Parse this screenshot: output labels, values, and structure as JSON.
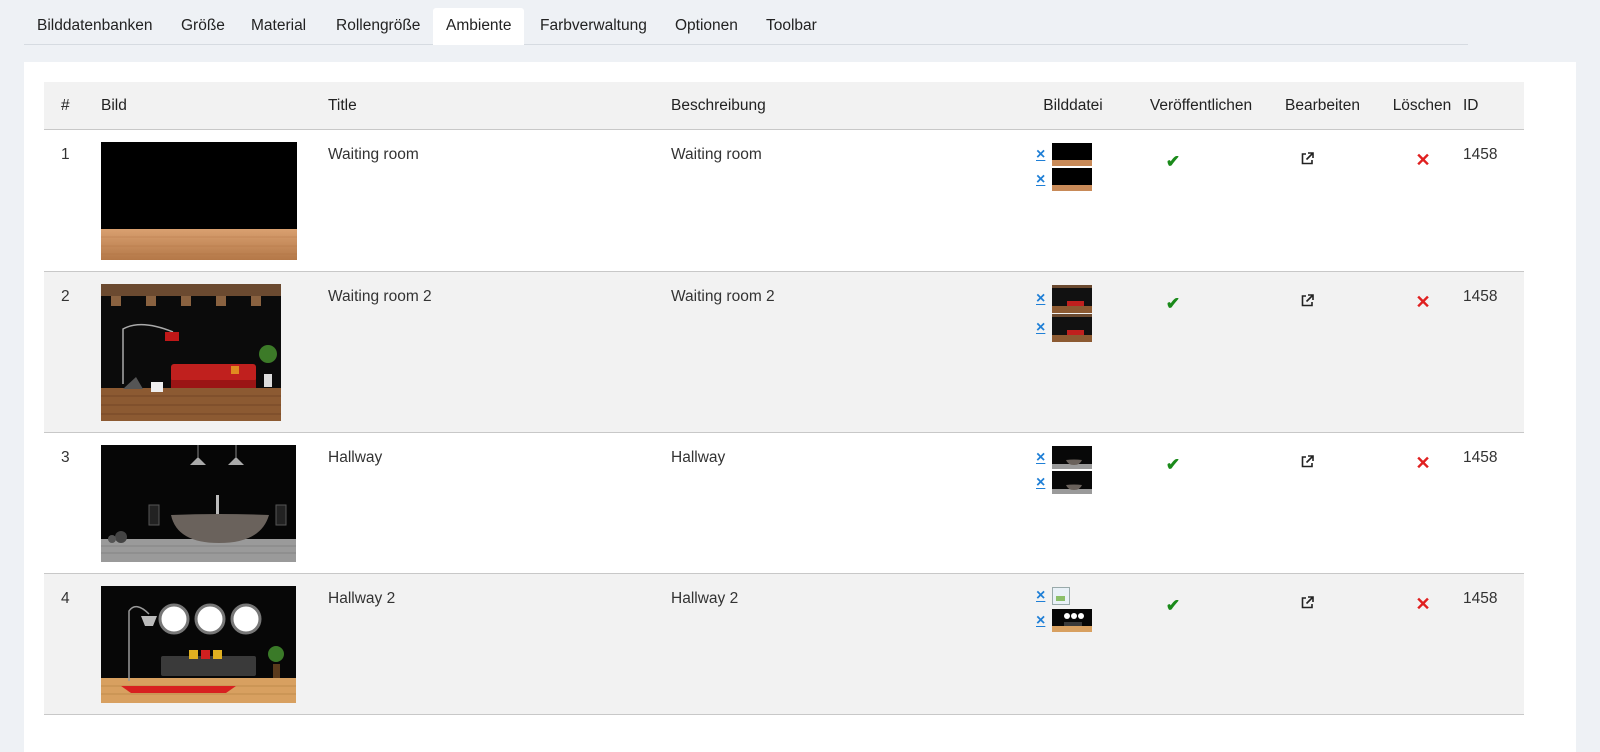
{
  "tabs": [
    {
      "label": "Bilddatenbanken"
    },
    {
      "label": "Größe"
    },
    {
      "label": "Material"
    },
    {
      "label": "Rollengröße"
    },
    {
      "label": "Ambiente",
      "active": true
    },
    {
      "label": "Farbverwaltung"
    },
    {
      "label": "Optionen"
    },
    {
      "label": "Toolbar"
    }
  ],
  "table": {
    "headers": {
      "num": "#",
      "image": "Bild",
      "title": "Title",
      "description": "Beschreibung",
      "file": "Bilddatei",
      "publish": "Veröffentlichen",
      "edit": "Bearbeiten",
      "delete": "Löschen",
      "id": "ID"
    },
    "rows": [
      {
        "num": "1",
        "title": "Waiting room",
        "description": "Waiting room",
        "id": "1458",
        "scene": "waiting-room",
        "published": true
      },
      {
        "num": "2",
        "title": "Waiting room 2",
        "description": "Waiting room 2",
        "id": "1458",
        "scene": "waiting-room-2",
        "published": true
      },
      {
        "num": "3",
        "title": "Hallway",
        "description": "Hallway",
        "id": "1458",
        "scene": "hallway",
        "published": true
      },
      {
        "num": "4",
        "title": "Hallway 2",
        "description": "Hallway 2",
        "id": "1458",
        "scene": "hallway-2",
        "published": true
      }
    ]
  },
  "icons": {
    "remove": "×",
    "publish": "check-icon",
    "edit": "external-link-icon",
    "delete": "close-icon"
  },
  "colors": {
    "accent": "#1f7fd6",
    "success": "#1a8a1a",
    "danger": "#e02020"
  }
}
